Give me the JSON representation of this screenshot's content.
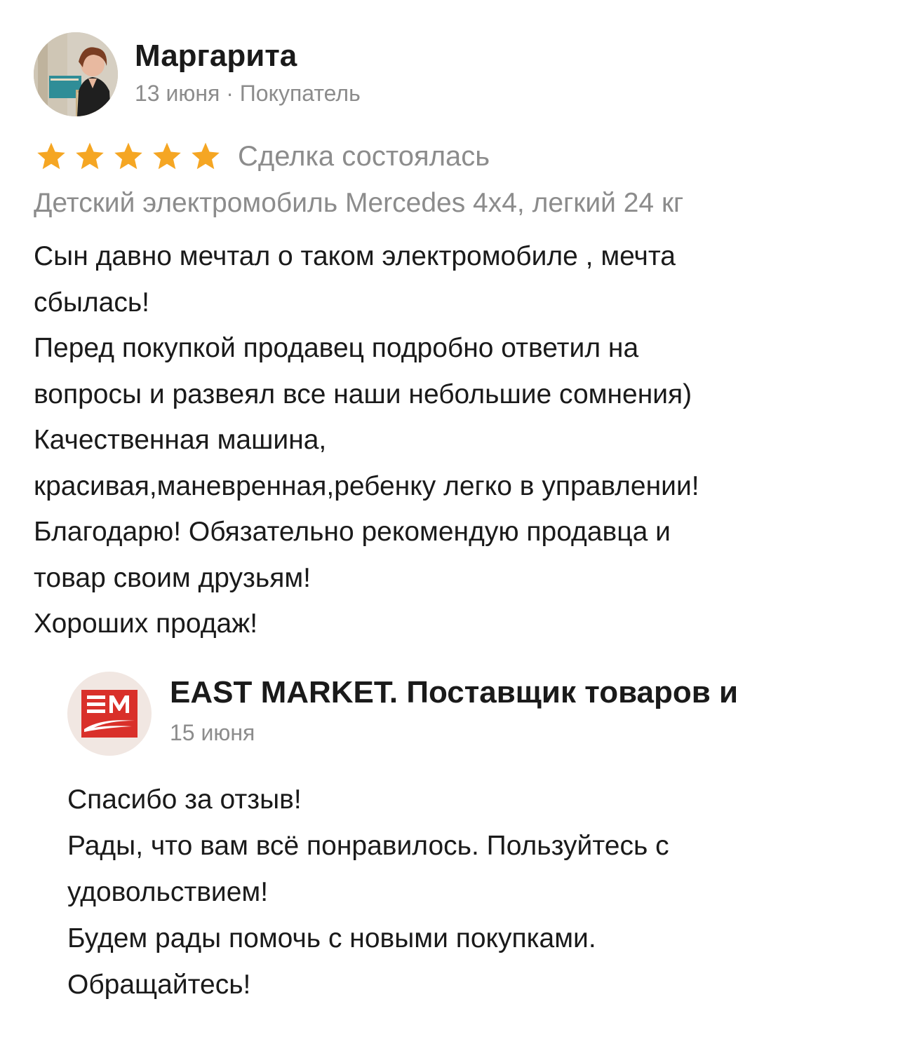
{
  "review": {
    "author": "Маргарита",
    "meta": "13 июня · Покупатель",
    "rating": 5,
    "rating_max": 5,
    "status": "Сделка состоялась",
    "product": "Детский электромобиль Mercedes 4x4, легкий 24 кг",
    "body_lines": [
      "Сын давно мечтал о таком электромобиле , мечта",
      "сбылась!",
      "Перед покупкой продавец подробно ответил на",
      "вопросы и развеял все наши небольшие   сомнения)",
      "Качественная машина,",
      "красивая,маневренная,ребенку легко в управлении!",
      "Благодарю! Обязательно рекомендую  продавца и",
      "товар своим друзьям!",
      "Хороших продаж!"
    ]
  },
  "reply": {
    "seller_name": "EAST MARKET. Поставщик товаров и",
    "logo_text": "EM",
    "date": "15 июня",
    "body_lines": [
      "Спасибо за отзыв!",
      "Рады, что вам всё понравилось. Пользуйтесь с",
      "удовольствием!",
      "Будем рады помочь с новыми покупками.",
      "Обращайтесь!"
    ]
  },
  "icons": {
    "star": "star-icon",
    "avatar": "user-photo"
  },
  "colors": {
    "star": "#f5a623",
    "muted_text": "#8c8c8c",
    "text": "#1a1a1a",
    "logo_red": "#d9302a",
    "logo_bg": "#f1e7e2"
  }
}
